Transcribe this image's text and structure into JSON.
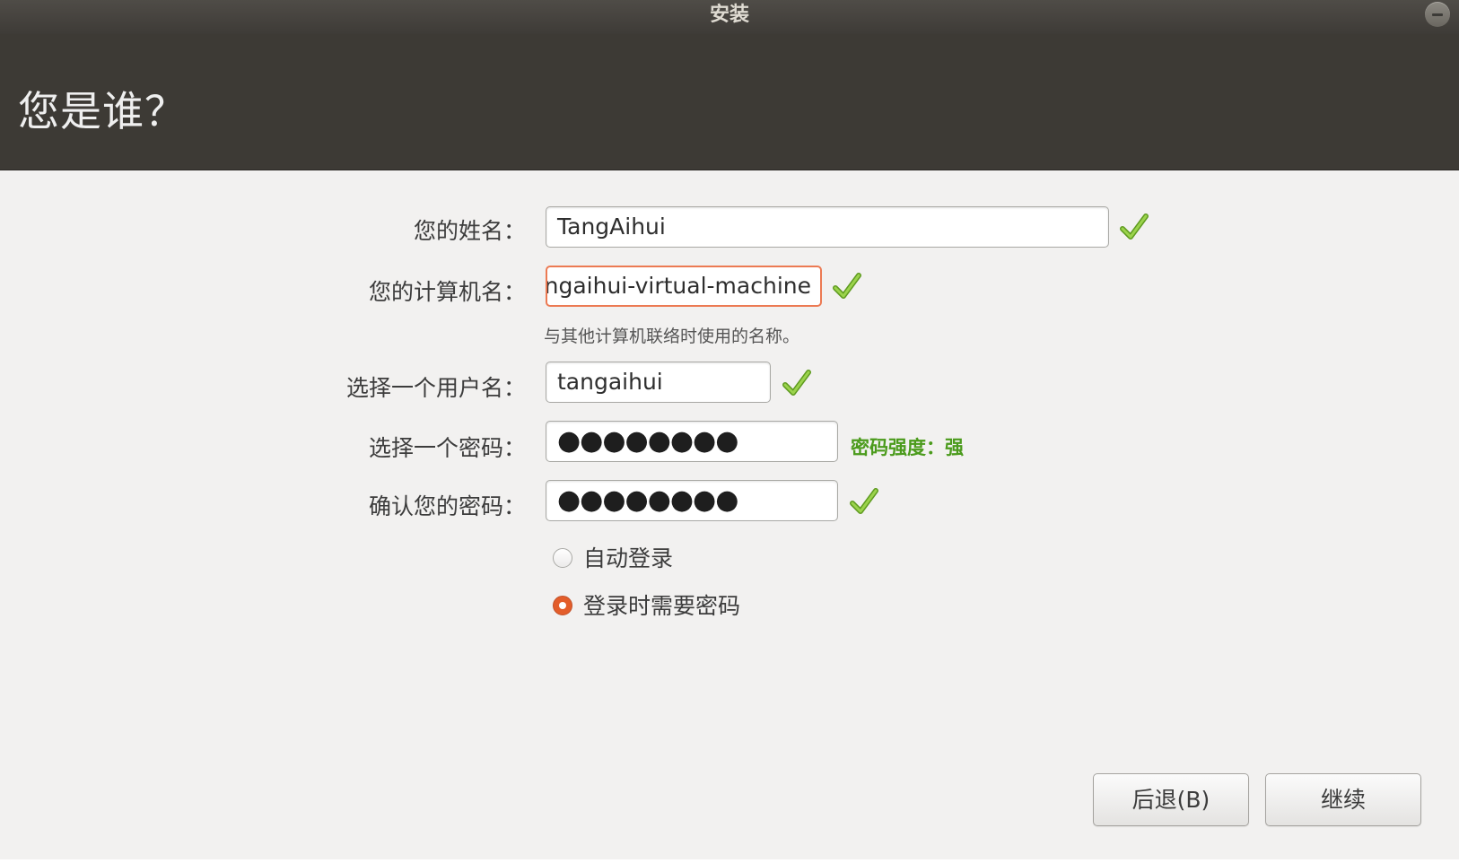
{
  "window": {
    "title": "安装"
  },
  "header": {
    "title": "您是谁？"
  },
  "form": {
    "name_label": "您的姓名：",
    "name_value": "TangAihui",
    "computer_label": "您的计算机名：",
    "computer_value": "tangaihui-virtual-machine",
    "computer_hint": "与其他计算机联络时使用的名称。",
    "username_label": "选择一个用户名：",
    "username_value": "tangaihui",
    "password_label": "选择一个密码：",
    "password_mask": "●●●●●●●●",
    "password_strength": "密码强度：强",
    "confirm_label": "确认您的密码：",
    "confirm_mask": "●●●●●●●●"
  },
  "login_options": {
    "auto_login_label": "自动登录",
    "require_password_label": "登录时需要密码",
    "selected": "require_password"
  },
  "buttons": {
    "back_label": "后退(B)",
    "continue_label": "继续"
  },
  "colors": {
    "header_bg": "#3d3a35",
    "accent_orange": "#e35d2a",
    "check_green": "#7cb82f",
    "strength_green": "#4b9b1c"
  }
}
